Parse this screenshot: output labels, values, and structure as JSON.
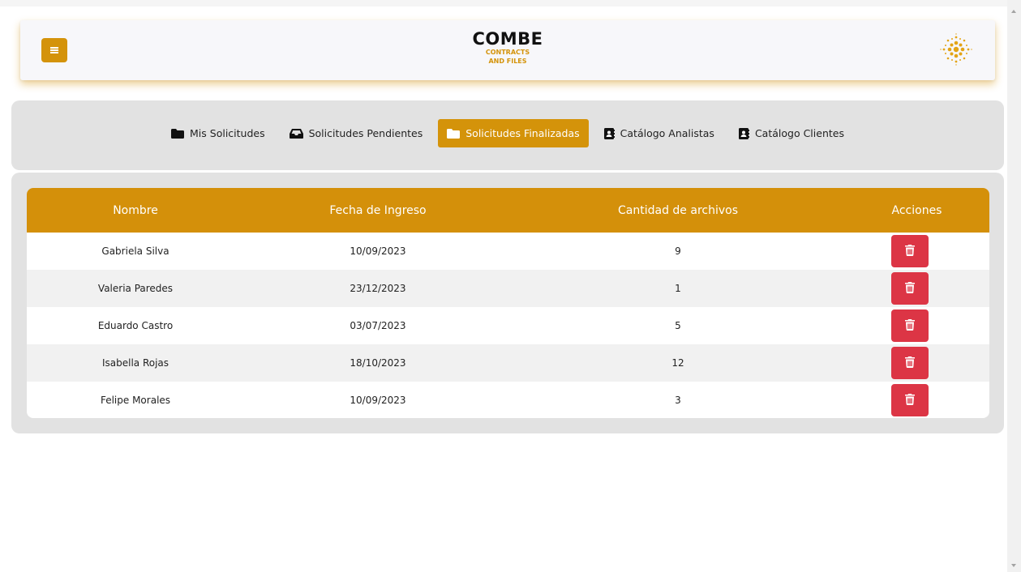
{
  "brand": {
    "title": "COMBE",
    "subtitle_line1": "CONTRACTS",
    "subtitle_line2": "AND FILES",
    "accent_color": "#d4930a"
  },
  "nav": {
    "items": [
      {
        "label": "Mis Solicitudes",
        "icon": "folder-icon",
        "active": false
      },
      {
        "label": "Solicitudes Pendientes",
        "icon": "inbox-icon",
        "active": false
      },
      {
        "label": "Solicitudes Finalizadas",
        "icon": "folder-icon",
        "active": true
      },
      {
        "label": "Catálogo Analistas",
        "icon": "address-book-icon",
        "active": false
      },
      {
        "label": "Catálogo Clientes",
        "icon": "address-book-icon",
        "active": false
      }
    ]
  },
  "table": {
    "headers": [
      "Nombre",
      "Fecha de Ingreso",
      "Cantidad de archivos",
      "Acciones"
    ],
    "rows": [
      {
        "nombre": "Gabriela Silva",
        "fecha": "10/09/2023",
        "cantidad": "9"
      },
      {
        "nombre": "Valeria Paredes",
        "fecha": "23/12/2023",
        "cantidad": "1"
      },
      {
        "nombre": "Eduardo Castro",
        "fecha": "03/07/2023",
        "cantidad": "5"
      },
      {
        "nombre": "Isabella Rojas",
        "fecha": "18/10/2023",
        "cantidad": "12"
      },
      {
        "nombre": "Felipe Morales",
        "fecha": "10/09/2023",
        "cantidad": "3"
      }
    ],
    "header_color": "#d4900a",
    "delete_color": "#dc3545"
  }
}
